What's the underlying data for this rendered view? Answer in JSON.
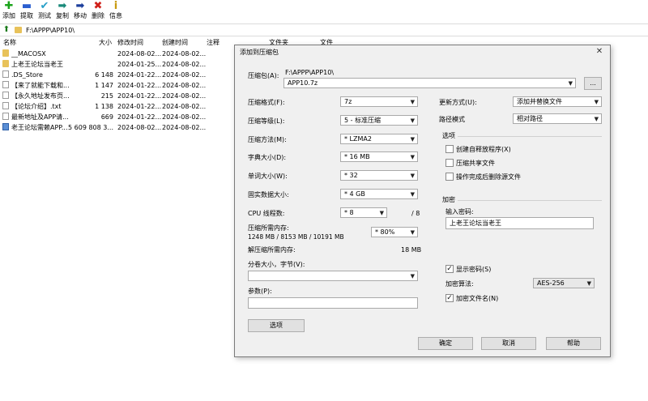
{
  "toolbar": {
    "add": "添加",
    "extract": "提取",
    "test": "测试",
    "copy": "复制",
    "move": "移动",
    "delete": "删除",
    "info": "信息"
  },
  "address": {
    "path": "F:\\APPP\\APP10\\"
  },
  "columns": {
    "name": "名称",
    "size": "大小",
    "modified": "修改时间",
    "created": "创建时间",
    "comment": "注释",
    "folders": "文件夹",
    "files": "文件"
  },
  "files": [
    {
      "icon": "folder",
      "name": "__MACOSX",
      "size": "",
      "modified": "2024-08-02...",
      "created": "2024-08-02..."
    },
    {
      "icon": "folder",
      "name": "上老王论坛当老王",
      "size": "",
      "modified": "2024-01-25...",
      "created": "2024-08-02..."
    },
    {
      "icon": "file",
      "name": ".DS_Store",
      "size": "6 148",
      "modified": "2024-01-22...",
      "created": "2024-08-02..."
    },
    {
      "icon": "file",
      "name": "【来了就能下载和...",
      "size": "1 147",
      "modified": "2024-01-22...",
      "created": "2024-08-02..."
    },
    {
      "icon": "file",
      "name": "【永久地址发布页...",
      "size": "215",
      "modified": "2024-01-22...",
      "created": "2024-08-02..."
    },
    {
      "icon": "file",
      "name": "【论坛介绍】.txt",
      "size": "1 138",
      "modified": "2024-01-22...",
      "created": "2024-08-02..."
    },
    {
      "icon": "file",
      "name": "最新地址及APP请...",
      "size": "669",
      "modified": "2024-01-22...",
      "created": "2024-08-02..."
    },
    {
      "icon": "exe",
      "name": "老王论坛需赖APP...",
      "size": "5 609 808 3...",
      "modified": "2024-08-02...",
      "created": "2024-08-02..."
    }
  ],
  "dialog": {
    "title": "添加到压缩包",
    "close": "✕",
    "archive_label": "压缩包(A):",
    "archive_dir": "F:\\APPP\\APP10\\",
    "archive_name": "APP10.7z",
    "browse": "...",
    "format_label": "压缩格式(F):",
    "format": "7z",
    "level_label": "压缩等级(L):",
    "level": "5 - 标准压缩",
    "method_label": "压缩方法(M):",
    "method": "* LZMA2",
    "dict_label": "字典大小(D):",
    "dict": "* 16 MB",
    "word_label": "单词大小(W):",
    "word": "* 32",
    "solid_label": "固实数据大小:",
    "solid": "* 4 GB",
    "threads_label": "CPU 线程数:",
    "threads": "* 8",
    "threads_max": "/ 8",
    "mem_comp_label": "压缩所需内存:",
    "mem_comp_detail": "1248 MB / 8153 MB / 10191 MB",
    "mem_percent": "* 80%",
    "mem_decomp_label": "解压缩所需内存:",
    "mem_decomp": "18 MB",
    "volume_label": "分卷大小，字节(V):",
    "params_label": "参数(P):",
    "options_button": "选项",
    "update_label": "更新方式(U):",
    "update": "添加并替换文件",
    "pathmode_label": "路径模式",
    "pathmode": "相对路径",
    "options_group": "选项",
    "opt_sfx": "创建自释放程序(X)",
    "opt_shared": "压缩共享文件",
    "opt_delete": "操作完成后删除源文件",
    "encryption_group": "加密",
    "password_label": "输入密码:",
    "password": "上老王论坛当老王",
    "show_password": "显示密码(S)",
    "enc_method_label": "加密算法:",
    "enc_method": "AES-256",
    "encrypt_names": "加密文件名(N)",
    "ok": "确定",
    "cancel": "取消",
    "help": "帮助"
  }
}
